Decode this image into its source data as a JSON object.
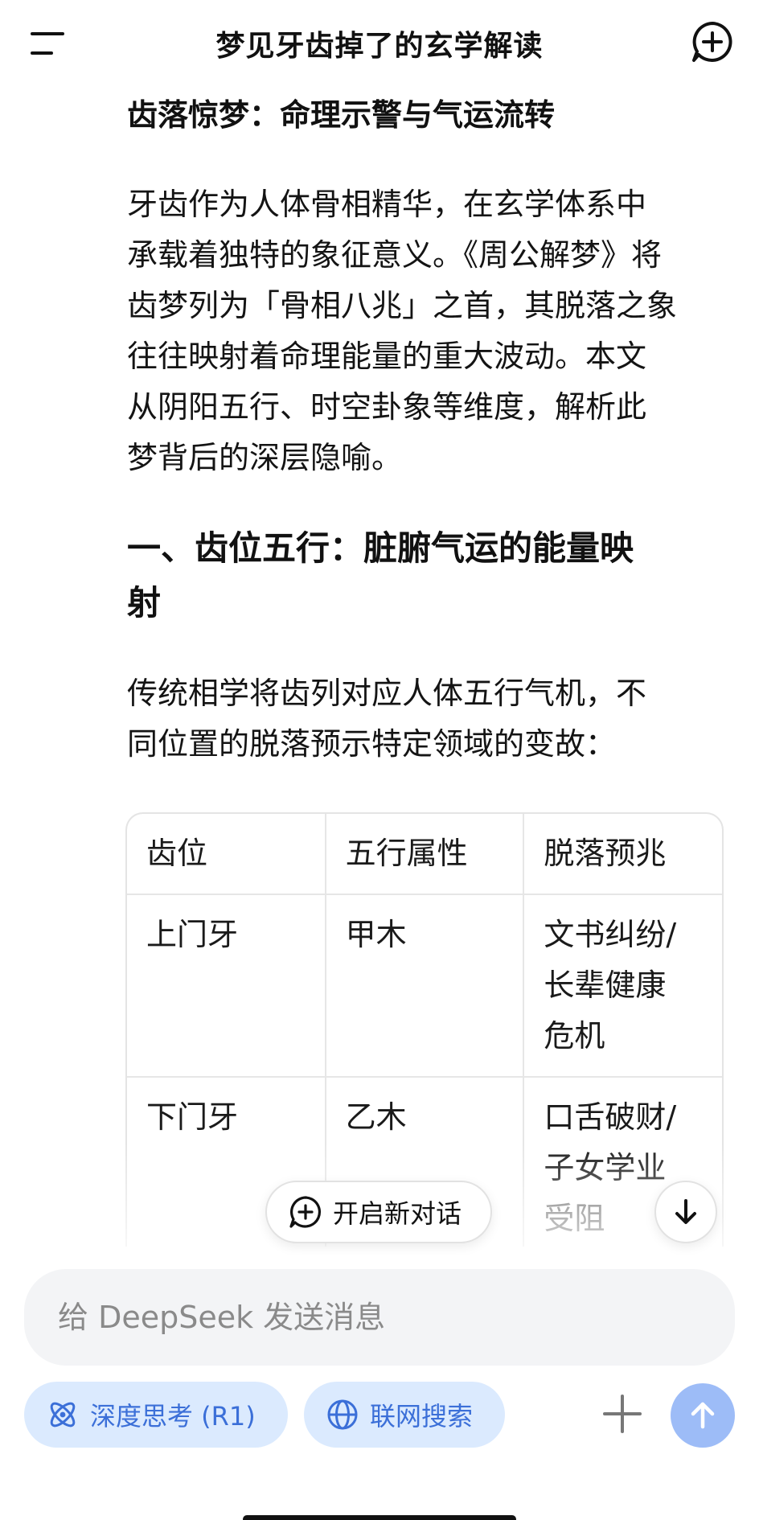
{
  "header": {
    "title": "梦见牙齿掉了的玄学解读"
  },
  "article": {
    "subtitle": "齿落惊梦：命理示警与气运流转",
    "intro_lines": [
      "牙齿作为人体骨相精华，在玄学体系中",
      "承载着独特的象征意义。《周公解梦》将",
      "齿梦列为「骨相八兆」之首，其脱落之象",
      "往往映射着命理能量的重大波动。本文",
      "从阴阳五行、时空卦象等维度，解析此",
      "梦背后的深层隐喻。"
    ],
    "section1_lines": [
      "一、齿位五行：脏腑气运的能量映",
      "射"
    ],
    "section1_para_lines": [
      "传统相学将齿列对应人体五行气机，不",
      "同位置的脱落预示特定领域的变故："
    ]
  },
  "table": {
    "headers": [
      "齿位",
      "五行属性",
      "脱落预兆"
    ],
    "rows": [
      {
        "position": "上门牙",
        "element": "甲木",
        "omen_lines": [
          "文书纠纷/",
          "长辈健康",
          "危机"
        ]
      },
      {
        "position": "下门牙",
        "element": "乙木",
        "omen_lines": [
          "口舌破财/",
          "子女学业",
          "受阻"
        ]
      }
    ]
  },
  "floating": {
    "new_dialog_label": "开启新对话"
  },
  "composer": {
    "placeholder": "给 DeepSeek 发送消息",
    "deep_think_label": "深度思考 (R1)",
    "web_search_label": "联网搜索"
  },
  "colors": {
    "accent_blue": "#3b6fd8",
    "chip_bg": "#dbeafe",
    "send_btn": "#9dbcf7"
  },
  "icons": {
    "menu": "menu-icon",
    "new_chat": "new-chat-icon",
    "scroll_down": "arrow-down-icon",
    "deep_think": "atom-icon",
    "web_search": "globe-icon",
    "plus": "plus-icon",
    "send": "arrow-up-icon"
  }
}
